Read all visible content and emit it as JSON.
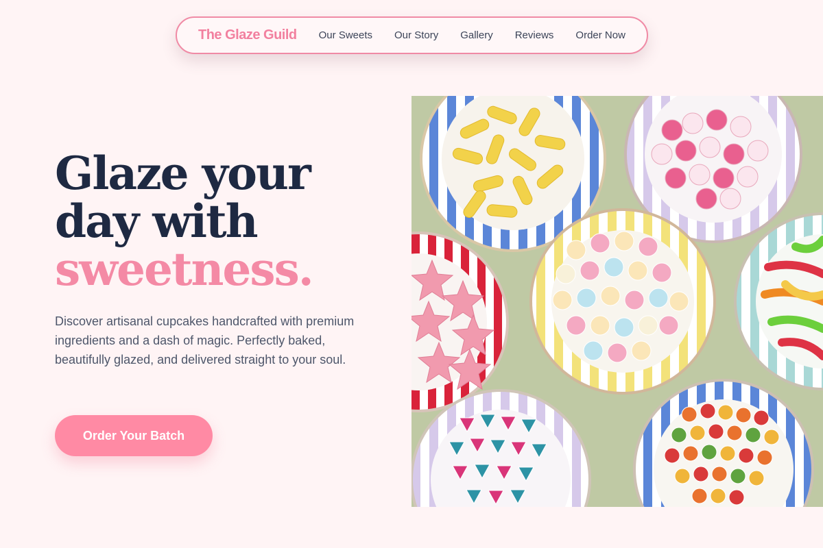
{
  "nav": {
    "brand": "The Glaze Guild",
    "links": [
      "Our Sweets",
      "Our Story",
      "Gallery",
      "Reviews",
      "Order Now"
    ]
  },
  "hero": {
    "headline_line1": "Glaze your",
    "headline_line2": "day with",
    "headline_accent": "sweetness.",
    "description": "Discover artisanal cupcakes handcrafted with premium ingredients and a dash of magic. Perfectly baked, beautifully glazed, and delivered straight to your soul.",
    "cta_label": "Order Your Batch"
  },
  "colors": {
    "background": "#fff4f5",
    "accent_pink": "#f48aa5",
    "headline_navy": "#1e2942",
    "body_text": "#4d566a",
    "cta_pink": "#ff8aa4",
    "photo_backdrop_green": "#bfc9a4"
  },
  "image": {
    "subject": "plates-of-candy-photo"
  }
}
